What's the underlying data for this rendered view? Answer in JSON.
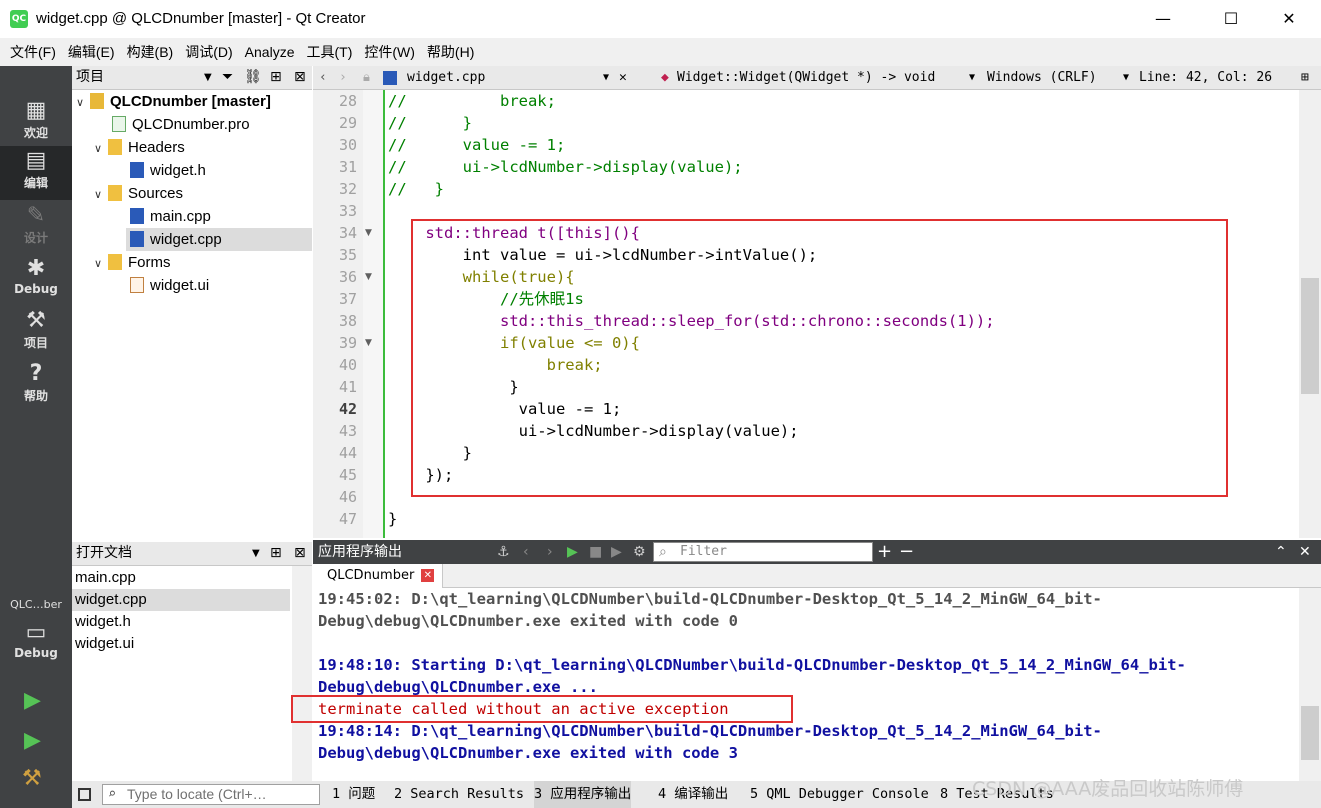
{
  "window": {
    "title": "widget.cpp @ QLCDnumber [master] - Qt Creator",
    "app_icon_text": "QC",
    "minimize": "—",
    "maximize": "☐",
    "close": "✕"
  },
  "menu": [
    "文件(F)",
    "编辑(E)",
    "构建(B)",
    "调试(D)",
    "Analyze",
    "工具(T)",
    "控件(W)",
    "帮助(H)"
  ],
  "modes": [
    {
      "label": "欢迎",
      "icon": "grid-icon"
    },
    {
      "label": "编辑",
      "icon": "edit-icon"
    },
    {
      "label": "设计",
      "icon": "design-icon"
    },
    {
      "label": "Debug",
      "icon": "bug-icon"
    },
    {
      "label": "项目",
      "icon": "wrench-icon"
    },
    {
      "label": "帮助",
      "icon": "help-icon"
    }
  ],
  "kit": {
    "name": "QLC…ber",
    "mode": "Debug"
  },
  "project_pane": {
    "title": "项目",
    "tree": [
      {
        "label": "QLCDnumber [master]",
        "depth": 0,
        "expanded": true,
        "bold": true
      },
      {
        "label": "QLCDnumber.pro",
        "depth": 1
      },
      {
        "label": "Headers",
        "depth": 1,
        "expanded": true
      },
      {
        "label": "widget.h",
        "depth": 2
      },
      {
        "label": "Sources",
        "depth": 1,
        "expanded": true
      },
      {
        "label": "main.cpp",
        "depth": 2
      },
      {
        "label": "widget.cpp",
        "depth": 2,
        "selected": true
      },
      {
        "label": "Forms",
        "depth": 1,
        "expanded": true
      },
      {
        "label": "widget.ui",
        "depth": 2
      }
    ]
  },
  "open_docs": {
    "title": "打开文档",
    "items": [
      "main.cpp",
      "widget.cpp",
      "widget.h",
      "widget.ui"
    ],
    "selected": "widget.cpp"
  },
  "editor_toolbar": {
    "file": "widget.cpp",
    "symbol": "Widget::Widget(QWidget *) -> void",
    "line_endings": "Windows (CRLF)",
    "position": "Line: 42, Col: 26"
  },
  "code": {
    "current_line": 42,
    "lines": [
      {
        "n": 28,
        "text": "//          break;"
      },
      {
        "n": 29,
        "text": "//      }"
      },
      {
        "n": 30,
        "text": "//      value -= 1;"
      },
      {
        "n": 31,
        "text": "//      ui->lcdNumber->display(value);"
      },
      {
        "n": 32,
        "text": "//   }"
      },
      {
        "n": 33,
        "text": ""
      },
      {
        "n": 34,
        "text": "    std::thread t([this](){"
      },
      {
        "n": 35,
        "text": "        int value = ui->lcdNumber->intValue();"
      },
      {
        "n": 36,
        "text": "        while(true){"
      },
      {
        "n": 37,
        "text": "            //先休眠1s"
      },
      {
        "n": 38,
        "text": "            std::this_thread::sleep_for(std::chrono::seconds(1));"
      },
      {
        "n": 39,
        "text": "            if(value <= 0){"
      },
      {
        "n": 40,
        "text": "                 break;"
      },
      {
        "n": 41,
        "text": "             }"
      },
      {
        "n": 42,
        "text": "              value -= 1;"
      },
      {
        "n": 43,
        "text": "              ui->lcdNumber->display(value);"
      },
      {
        "n": 44,
        "text": "        }"
      },
      {
        "n": 45,
        "text": "    });"
      },
      {
        "n": 46,
        "text": ""
      },
      {
        "n": 47,
        "text": "}"
      }
    ]
  },
  "output_pane": {
    "title": "应用程序输出",
    "filter_placeholder": "Filter",
    "tab": "QLCDnumber",
    "lines": [
      {
        "text": "19:45:02: D:\\qt_learning\\QLCDNumber\\build-QLCDnumber-Desktop_Qt_5_14_2_MinGW_64_bit-",
        "style": "grey"
      },
      {
        "text": "Debug\\debug\\QLCDnumber.exe exited with code 0",
        "style": "grey"
      },
      {
        "text": "",
        "style": "grey"
      },
      {
        "text": "19:48:10: Starting D:\\qt_learning\\QLCDNumber\\build-QLCDnumber-Desktop_Qt_5_14_2_MinGW_64_bit-",
        "style": "blue"
      },
      {
        "text": "Debug\\debug\\QLCDnumber.exe ...",
        "style": "blue"
      },
      {
        "text": "terminate called without an active exception",
        "style": "red"
      },
      {
        "text": "19:48:14: D:\\qt_learning\\QLCDNumber\\build-QLCDnumber-Desktop_Qt_5_14_2_MinGW_64_bit-",
        "style": "blue"
      },
      {
        "text": "Debug\\debug\\QLCDnumber.exe exited with code 3",
        "style": "blue"
      }
    ]
  },
  "statusbar": {
    "locator_placeholder": "Type to locate (Ctrl+…",
    "tabs": [
      "1 问题",
      "2 Search Results",
      "3 应用程序输出",
      "4 编译输出",
      "5 QML Debugger Console",
      "8 Test Results"
    ],
    "active_tab": "3 应用程序输出"
  },
  "watermark": "CSDN @AAA废品回收站陈师傅"
}
